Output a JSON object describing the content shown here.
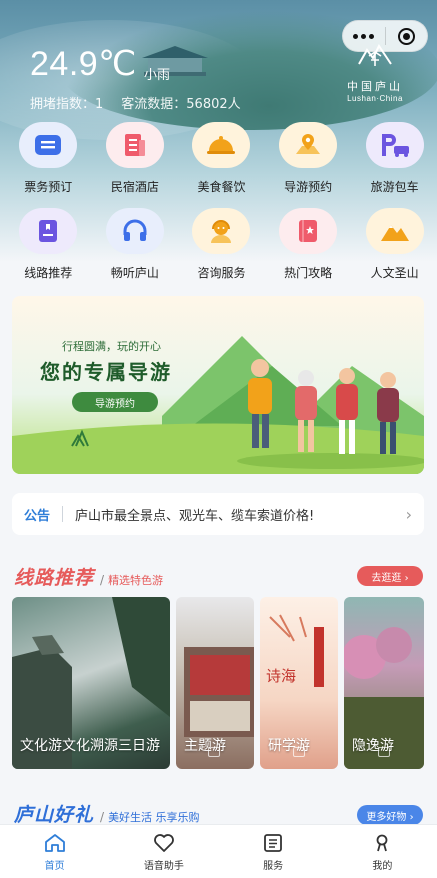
{
  "header": {
    "temperature": "24.9℃",
    "weather": "小雨",
    "congestion_label": "拥堵指数：1",
    "visitor_label": "客流数据：56802人",
    "logo_cn": "中国庐山",
    "logo_en": "Lushan·China"
  },
  "quick_actions": [
    {
      "label": "票务预订",
      "icon": "ticket-icon",
      "color": "#3d6fe8"
    },
    {
      "label": "民宿酒店",
      "icon": "hotel-icon",
      "color": "#ef5b6b"
    },
    {
      "label": "美食餐饮",
      "icon": "dish-icon",
      "color": "#f2a21a"
    },
    {
      "label": "导游预约",
      "icon": "guide-map-icon",
      "color": "#f2a21a"
    },
    {
      "label": "旅游包车",
      "icon": "parking-car-icon",
      "color": "#6b55e0"
    },
    {
      "label": "线路推荐",
      "icon": "route-book-icon",
      "color": "#6b55e0"
    },
    {
      "label": "畅听庐山",
      "icon": "headphones-icon",
      "color": "#3d6fe8"
    },
    {
      "label": "咨询服务",
      "icon": "service-agent-icon",
      "color": "#f2a21a"
    },
    {
      "label": "热门攻略",
      "icon": "guide-book-icon",
      "color": "#ef5b6b"
    },
    {
      "label": "人文圣山",
      "icon": "mountain-icon",
      "color": "#f2a21a"
    }
  ],
  "banner": {
    "subtitle": "行程圆满，玩的开心",
    "title": "您的专属导游",
    "button": "导游预约"
  },
  "notice": {
    "tag": "公告",
    "text": "庐山市最全景点、观光车、缆车索道价格!"
  },
  "routes": {
    "title": "线路推荐",
    "desc": "精选特色游",
    "more": "去逛逛 ›",
    "cards": [
      {
        "label": "文化游文化溯源三日游"
      },
      {
        "label": "主题游"
      },
      {
        "label": "研学游"
      },
      {
        "label": "隐逸游"
      }
    ]
  },
  "gifts": {
    "title": "庐山好礼",
    "desc": "美好生活 乐享乐购",
    "more": "更多好物 ›"
  },
  "tabbar": [
    {
      "label": "首页",
      "icon": "home-icon"
    },
    {
      "label": "语音助手",
      "icon": "heart-icon"
    },
    {
      "label": "服务",
      "icon": "list-icon"
    },
    {
      "label": "我的",
      "icon": "user-icon"
    }
  ],
  "colors": {
    "accent": "#2f7ed8",
    "route_red": "#e65b5b",
    "gift_blue": "#4a86e8"
  }
}
